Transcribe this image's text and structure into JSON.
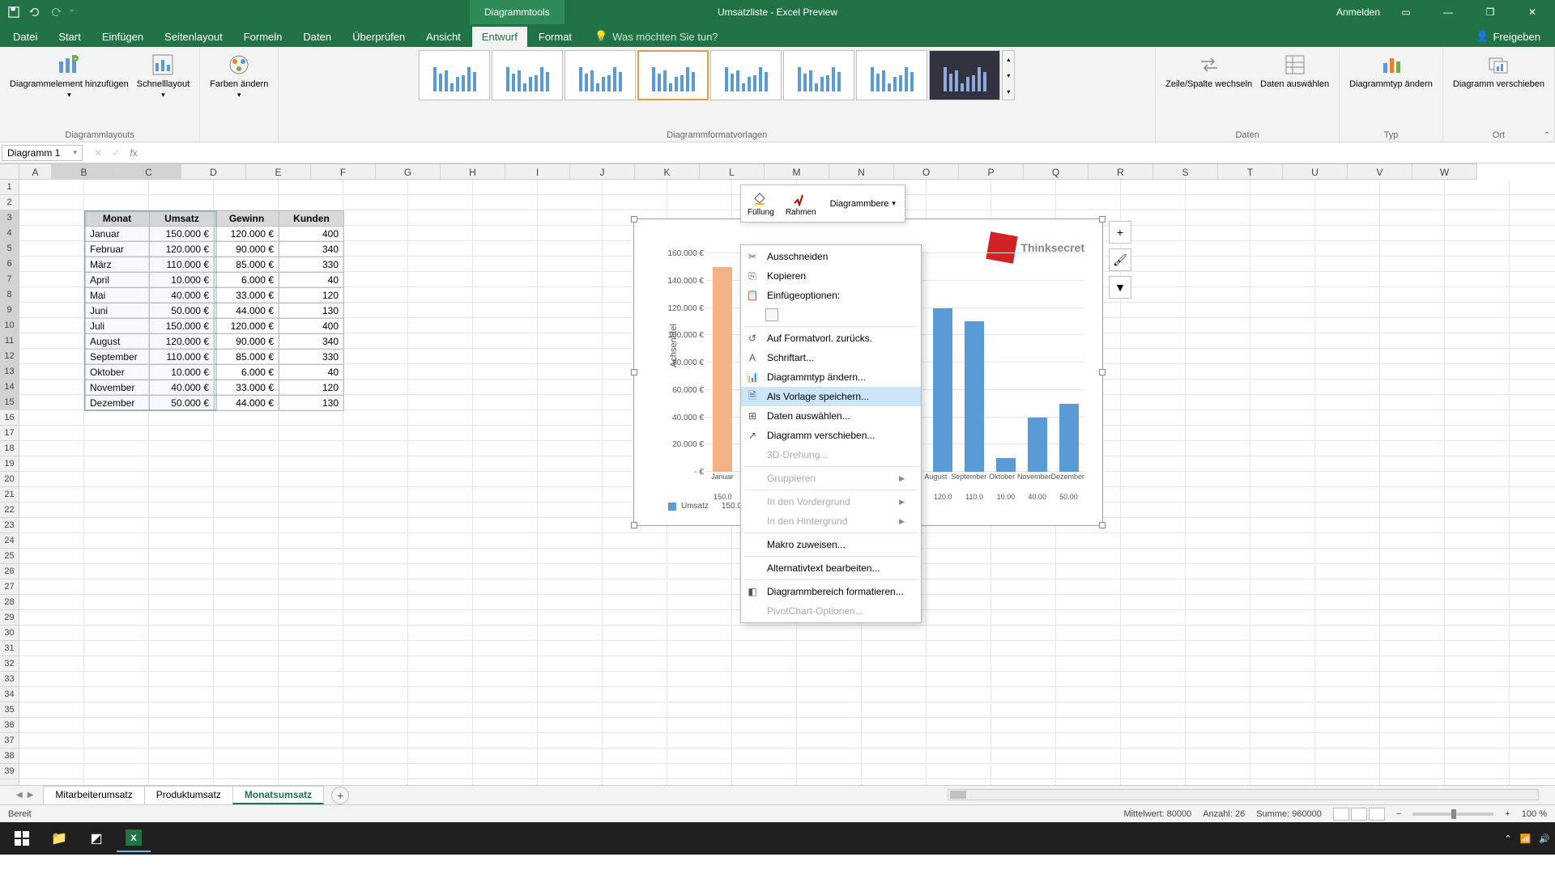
{
  "app": {
    "contextualTab": "Diagrammtools",
    "documentTitle": "Umsatzliste - Excel Preview",
    "signIn": "Anmelden"
  },
  "ribbon": {
    "tabs": [
      "Datei",
      "Start",
      "Einfügen",
      "Seitenlayout",
      "Formeln",
      "Daten",
      "Überprüfen",
      "Ansicht",
      "Entwurf",
      "Format"
    ],
    "activeTab": "Entwurf",
    "tellMe": "Was möchten Sie tun?",
    "share": "Freigeben",
    "groups": {
      "layouts": {
        "label": "Diagrammlayouts",
        "addElement": "Diagrammelement hinzufügen",
        "quickLayout": "Schnelllayout"
      },
      "colors": {
        "changeColors": "Farben ändern"
      },
      "styles": {
        "label": "Diagrammformatvorlagen"
      },
      "data": {
        "label": "Daten",
        "switchRowCol": "Zeile/Spalte wechseln",
        "selectData": "Daten auswählen"
      },
      "type": {
        "label": "Typ",
        "changeType": "Diagrammtyp ändern"
      },
      "location": {
        "label": "Ort",
        "moveChart": "Diagramm verschieben"
      }
    }
  },
  "nameBox": "Diagramm 1",
  "table": {
    "headers": [
      "Monat",
      "Umsatz",
      "Gewinn",
      "Kunden"
    ],
    "rows": [
      [
        "Januar",
        "150.000 €",
        "120.000 €",
        "400"
      ],
      [
        "Februar",
        "120.000 €",
        "90.000 €",
        "340"
      ],
      [
        "März",
        "110.000 €",
        "85.000 €",
        "330"
      ],
      [
        "April",
        "10.000 €",
        "6.000 €",
        "40"
      ],
      [
        "Mai",
        "40.000 €",
        "33.000 €",
        "120"
      ],
      [
        "Juni",
        "50.000 €",
        "44.000 €",
        "130"
      ],
      [
        "Juli",
        "150.000 €",
        "120.000 €",
        "400"
      ],
      [
        "August",
        "120.000 €",
        "90.000 €",
        "340"
      ],
      [
        "September",
        "110.000 €",
        "85.000 €",
        "330"
      ],
      [
        "Oktober",
        "10.000 €",
        "6.000 €",
        "40"
      ],
      [
        "November",
        "40.000 €",
        "33.000 €",
        "120"
      ],
      [
        "Dezember",
        "50.000 €",
        "44.000 €",
        "130"
      ]
    ]
  },
  "columns": [
    "A",
    "B",
    "C",
    "D",
    "E",
    "F",
    "G",
    "H",
    "I",
    "J",
    "K",
    "L",
    "M",
    "N",
    "O",
    "P",
    "Q",
    "R",
    "S",
    "T",
    "U",
    "V",
    "W"
  ],
  "miniToolbar": {
    "fill": "Füllung",
    "outline": "Rahmen",
    "chartArea": "Diagrammbere"
  },
  "contextMenu": {
    "items": [
      {
        "label": "Ausschneiden",
        "icon": "cut-icon",
        "disabled": false
      },
      {
        "label": "Kopieren",
        "icon": "copy-icon",
        "disabled": false
      },
      {
        "label": "Einfügeoptionen:",
        "icon": "paste-icon",
        "disabled": false,
        "header": true
      },
      {
        "label": "",
        "icon": "paste-option-icon",
        "disabled": false,
        "indent": true
      },
      {
        "sep": true
      },
      {
        "label": "Auf Formatvorl. zurücks.",
        "icon": "reset-icon",
        "disabled": false
      },
      {
        "label": "Schriftart...",
        "icon": "font-icon",
        "disabled": false
      },
      {
        "label": "Diagrammtyp ändern...",
        "icon": "chart-type-icon",
        "disabled": false
      },
      {
        "label": "Als Vorlage speichern...",
        "icon": "template-icon",
        "disabled": false,
        "hovered": true
      },
      {
        "label": "Daten auswählen...",
        "icon": "select-data-icon",
        "disabled": false
      },
      {
        "label": "Diagramm verschieben...",
        "icon": "move-chart-icon",
        "disabled": false
      },
      {
        "label": "3D-Drehung...",
        "icon": "rotate-3d-icon",
        "disabled": true
      },
      {
        "sep": true
      },
      {
        "label": "Gruppieren",
        "icon": "group-icon",
        "disabled": true,
        "submenu": true
      },
      {
        "sep": true
      },
      {
        "label": "In den Vordergrund",
        "icon": "bring-front-icon",
        "disabled": true,
        "submenu": true
      },
      {
        "label": "In den Hintergrund",
        "icon": "send-back-icon",
        "disabled": true,
        "submenu": true
      },
      {
        "sep": true
      },
      {
        "label": "Makro zuweisen...",
        "icon": "macro-icon",
        "disabled": false
      },
      {
        "sep": true
      },
      {
        "label": "Alternativtext bearbeiten...",
        "icon": "alt-text-icon",
        "disabled": false
      },
      {
        "sep": true
      },
      {
        "label": "Diagrammbereich formatieren...",
        "icon": "format-area-icon",
        "disabled": false
      },
      {
        "label": "PivotChart-Optionen...",
        "icon": "pivot-icon",
        "disabled": true
      }
    ]
  },
  "chart_data": {
    "type": "bar",
    "categories": [
      "Januar",
      "Februar",
      "März",
      "April",
      "Mai",
      "Juni",
      "Juli",
      "August",
      "September",
      "Oktober",
      "November",
      "Dezember"
    ],
    "catShort": [
      "Januar",
      "",
      "",
      "",
      "",
      "",
      "",
      "August",
      "September",
      "Oktober",
      "November",
      "Dezember"
    ],
    "values": [
      150000,
      120000,
      110000,
      10000,
      40000,
      50000,
      150000,
      120000,
      110000,
      10000,
      40000,
      50000
    ],
    "dataLabels": [
      "150.0",
      "",
      "",
      "",
      "",
      "",
      "",
      "120.0",
      "110.0",
      "10.00",
      "40.00",
      "50.00"
    ],
    "ylabel": "Achsentitel",
    "ylim": [
      0,
      160000
    ],
    "yticks": [
      "- €",
      "20.000 €",
      "40.000 €",
      "60.000 €",
      "80.000 €",
      "100.000 €",
      "120.000 €",
      "140.000 €",
      "160.000 €"
    ],
    "legend": "Umsatz",
    "logo": "Thinksecret"
  },
  "sheets": {
    "tabs": [
      "Mitarbeiterumsatz",
      "Produktumsatz",
      "Monatsumsatz"
    ],
    "active": "Monatsumsatz"
  },
  "status": {
    "ready": "Bereit",
    "avg": "Mittelwert: 80000",
    "count": "Anzahl: 26",
    "sum": "Summe: 960000",
    "zoom": "100 %"
  }
}
